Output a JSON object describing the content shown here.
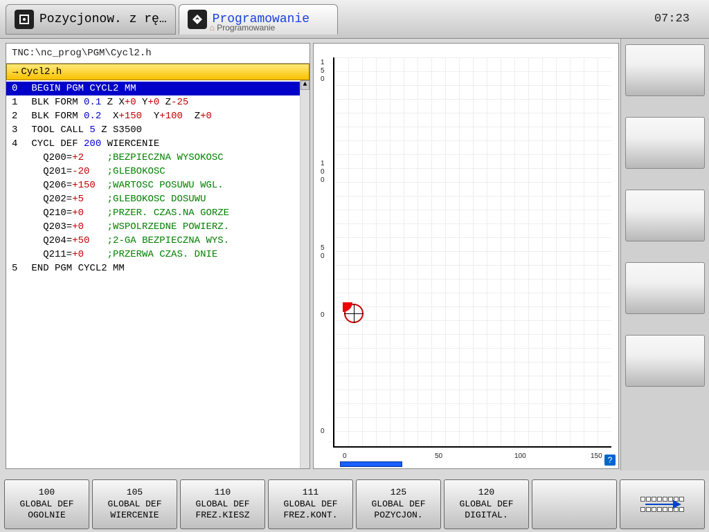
{
  "clock": "07:23",
  "tabs": [
    {
      "title": "Pozycjonow. z rę…",
      "active": false
    },
    {
      "title": "Programowanie",
      "subtitle": "Programowanie",
      "active": true
    }
  ],
  "file_path": "TNC:\\nc_prog\\PGM\\Cycl2.h",
  "file_name": "Cycl2.h",
  "code": [
    {
      "n": "0",
      "sel": true,
      "tokens": [
        [
          "kw-black",
          " BEGIN PGM CYCL2 MM"
        ]
      ]
    },
    {
      "n": "1",
      "tokens": [
        [
          "kw-black",
          " BLK FORM "
        ],
        [
          "kw-blue",
          "0.1"
        ],
        [
          "kw-black",
          " Z X"
        ],
        [
          "kw-red",
          "+0"
        ],
        [
          "kw-black",
          " Y"
        ],
        [
          "kw-red",
          "+0"
        ],
        [
          "kw-black",
          " Z"
        ],
        [
          "kw-red",
          "-25"
        ]
      ]
    },
    {
      "n": "2",
      "tokens": [
        [
          "kw-black",
          " BLK FORM "
        ],
        [
          "kw-blue",
          "0.2"
        ],
        [
          "kw-black",
          "  X"
        ],
        [
          "kw-red",
          "+150"
        ],
        [
          "kw-black",
          "  Y"
        ],
        [
          "kw-red",
          "+100"
        ],
        [
          "kw-black",
          "  Z"
        ],
        [
          "kw-red",
          "+0"
        ]
      ]
    },
    {
      "n": "3",
      "tokens": [
        [
          "kw-black",
          " TOOL CALL "
        ],
        [
          "kw-blue",
          "5"
        ],
        [
          "kw-black",
          " Z S3500"
        ]
      ]
    },
    {
      "n": "4",
      "tokens": [
        [
          "kw-black",
          " CYCL DEF "
        ],
        [
          "kw-blue",
          "200"
        ],
        [
          "kw-black",
          " WIERCENIE"
        ]
      ]
    },
    {
      "n": "",
      "tokens": [
        [
          "kw-black",
          "   Q200="
        ],
        [
          "kw-red",
          "+2"
        ],
        [
          "kw-black",
          "    "
        ],
        [
          "kw-green",
          ";BEZPIECZNA WYSOKOSC"
        ]
      ]
    },
    {
      "n": "",
      "tokens": [
        [
          "kw-black",
          "   Q201="
        ],
        [
          "kw-red",
          "-20"
        ],
        [
          "kw-black",
          "   "
        ],
        [
          "kw-green",
          ";GLEBOKOSC"
        ]
      ]
    },
    {
      "n": "",
      "tokens": [
        [
          "kw-black",
          "   Q206="
        ],
        [
          "kw-red",
          "+150"
        ],
        [
          "kw-black",
          "  "
        ],
        [
          "kw-green",
          ";WARTOSC POSUWU WGL."
        ]
      ]
    },
    {
      "n": "",
      "tokens": [
        [
          "kw-black",
          "   Q202="
        ],
        [
          "kw-red",
          "+5"
        ],
        [
          "kw-black",
          "    "
        ],
        [
          "kw-green",
          ";GLEBOKOSC DOSUWU"
        ]
      ]
    },
    {
      "n": "",
      "tokens": [
        [
          "kw-black",
          "   Q210="
        ],
        [
          "kw-red",
          "+0"
        ],
        [
          "kw-black",
          "    "
        ],
        [
          "kw-green",
          ";PRZER. CZAS.NA GORZE"
        ]
      ]
    },
    {
      "n": "",
      "tokens": [
        [
          "kw-black",
          "   Q203="
        ],
        [
          "kw-red",
          "+0"
        ],
        [
          "kw-black",
          "    "
        ],
        [
          "kw-green",
          ";WSPOLRZEDNE POWIERZ."
        ]
      ]
    },
    {
      "n": "",
      "tokens": [
        [
          "kw-black",
          "   Q204="
        ],
        [
          "kw-red",
          "+50"
        ],
        [
          "kw-black",
          "   "
        ],
        [
          "kw-green",
          ";2-GA BEZPIECZNA WYS."
        ]
      ]
    },
    {
      "n": "",
      "tokens": [
        [
          "kw-black",
          "   Q211="
        ],
        [
          "kw-red",
          "+0"
        ],
        [
          "kw-black",
          "    "
        ],
        [
          "kw-green",
          ";PRZERWA CZAS. DNIE"
        ]
      ]
    },
    {
      "n": "5",
      "tokens": [
        [
          "kw-black",
          " END PGM CYCL2 MM"
        ]
      ]
    }
  ],
  "graphic": {
    "x_ticks": [
      "0",
      "50",
      "100",
      "150"
    ],
    "y_ticks_top": [
      "1",
      "5",
      "0"
    ],
    "y_ticks_mid": [
      "1",
      "0",
      "0"
    ],
    "y_ticks_low": [
      "5",
      "0"
    ],
    "y_ticks_bot": [
      "0"
    ],
    "origin_label": "0"
  },
  "softkeys": [
    {
      "l1": "100",
      "l2": "GLOBAL DEF",
      "l3": "OGOLNIE"
    },
    {
      "l1": "105",
      "l2": "GLOBAL DEF",
      "l3": "WIERCENIE"
    },
    {
      "l1": "110",
      "l2": "GLOBAL DEF",
      "l3": "FREZ.KIESZ"
    },
    {
      "l1": "111",
      "l2": "GLOBAL DEF",
      "l3": "FREZ.KONT."
    },
    {
      "l1": "125",
      "l2": "GLOBAL DEF",
      "l3": "POZYCJON."
    },
    {
      "l1": "120",
      "l2": "GLOBAL DEF",
      "l3": "DIGITAL."
    }
  ]
}
